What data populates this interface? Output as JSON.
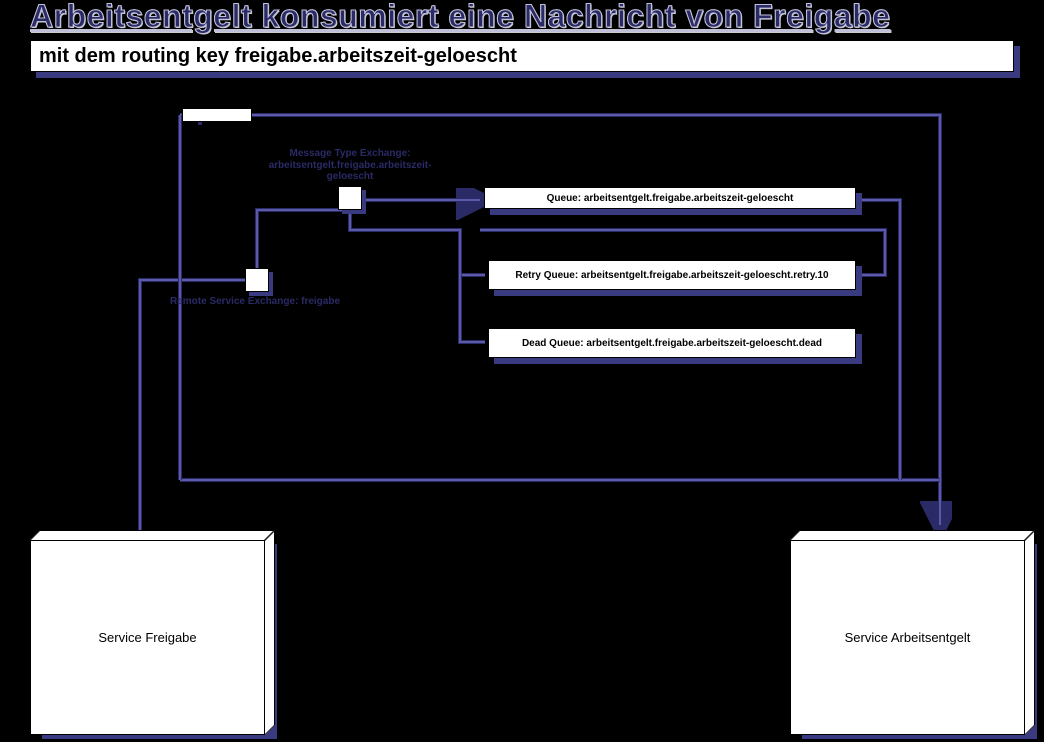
{
  "header": {
    "title": "Arbeitsentgelt konsumiert eine Nachricht von Freigabe",
    "subtitle": "mit dem routing key freigabe.arbeitszeit-geloescht"
  },
  "exchanges": {
    "messageType": {
      "label": "Message Type Exchange: arbeitsentgelt.freigabe.arbeitszeit-geloescht"
    },
    "remoteService": {
      "label": "Remote Service Exchange: freigabe"
    }
  },
  "queues": {
    "main": "Queue: arbeitsentgelt.freigabe.arbeitszeit-geloescht",
    "retry": "Retry Queue: arbeitsentgelt.freigabe.arbeitszeit-geloescht.retry.10",
    "dead": "Dead Queue: arbeitsentgelt.freigabe.arbeitszeit-geloescht.dead"
  },
  "services": {
    "left": "Service Freigabe",
    "right": "Service Arbeitsentgelt"
  },
  "colors": {
    "navy": "#2a2a66",
    "shadow": "#3a3a80"
  }
}
